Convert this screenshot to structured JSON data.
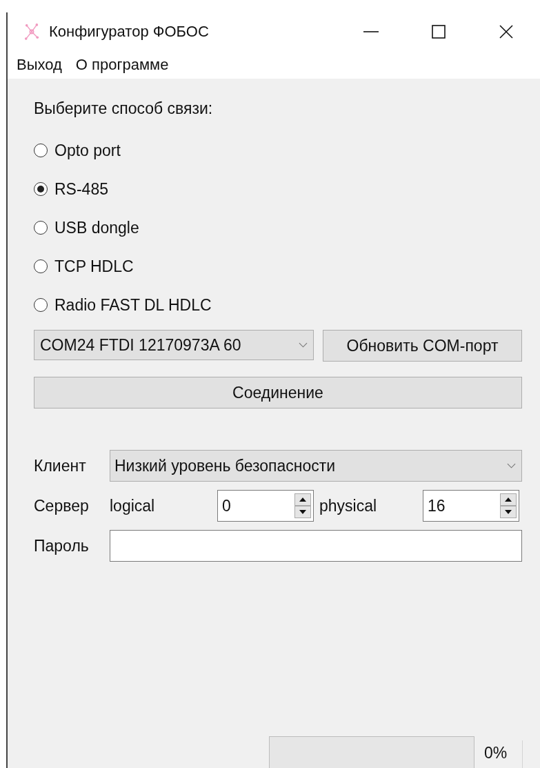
{
  "window": {
    "title": "Конфигуратор ФОБОС"
  },
  "menu": [
    "Выход",
    "О программе"
  ],
  "connection": {
    "label": "Выберите способ связи:",
    "options": [
      {
        "label": "Opto port",
        "selected": false
      },
      {
        "label": "RS-485",
        "selected": true
      },
      {
        "label": "USB dongle",
        "selected": false
      },
      {
        "label": "TCP HDLC",
        "selected": false
      },
      {
        "label": "Radio FAST DL HDLC",
        "selected": false
      }
    ],
    "port": {
      "value": "COM24 FTDI 12170973A 60"
    },
    "refresh_button": "Обновить COM-порт",
    "connect_button": "Соединение"
  },
  "client": {
    "label": "Клиент",
    "value": "Низкий уровень безопасности"
  },
  "server": {
    "label": "Сервер",
    "logical_label": "logical",
    "logical": "0",
    "physical_label": "physical",
    "physical": "16"
  },
  "password": {
    "label": "Пароль"
  },
  "status_bar": {
    "progress": {
      "level": 0,
      "reading": "0%"
    }
  }
}
